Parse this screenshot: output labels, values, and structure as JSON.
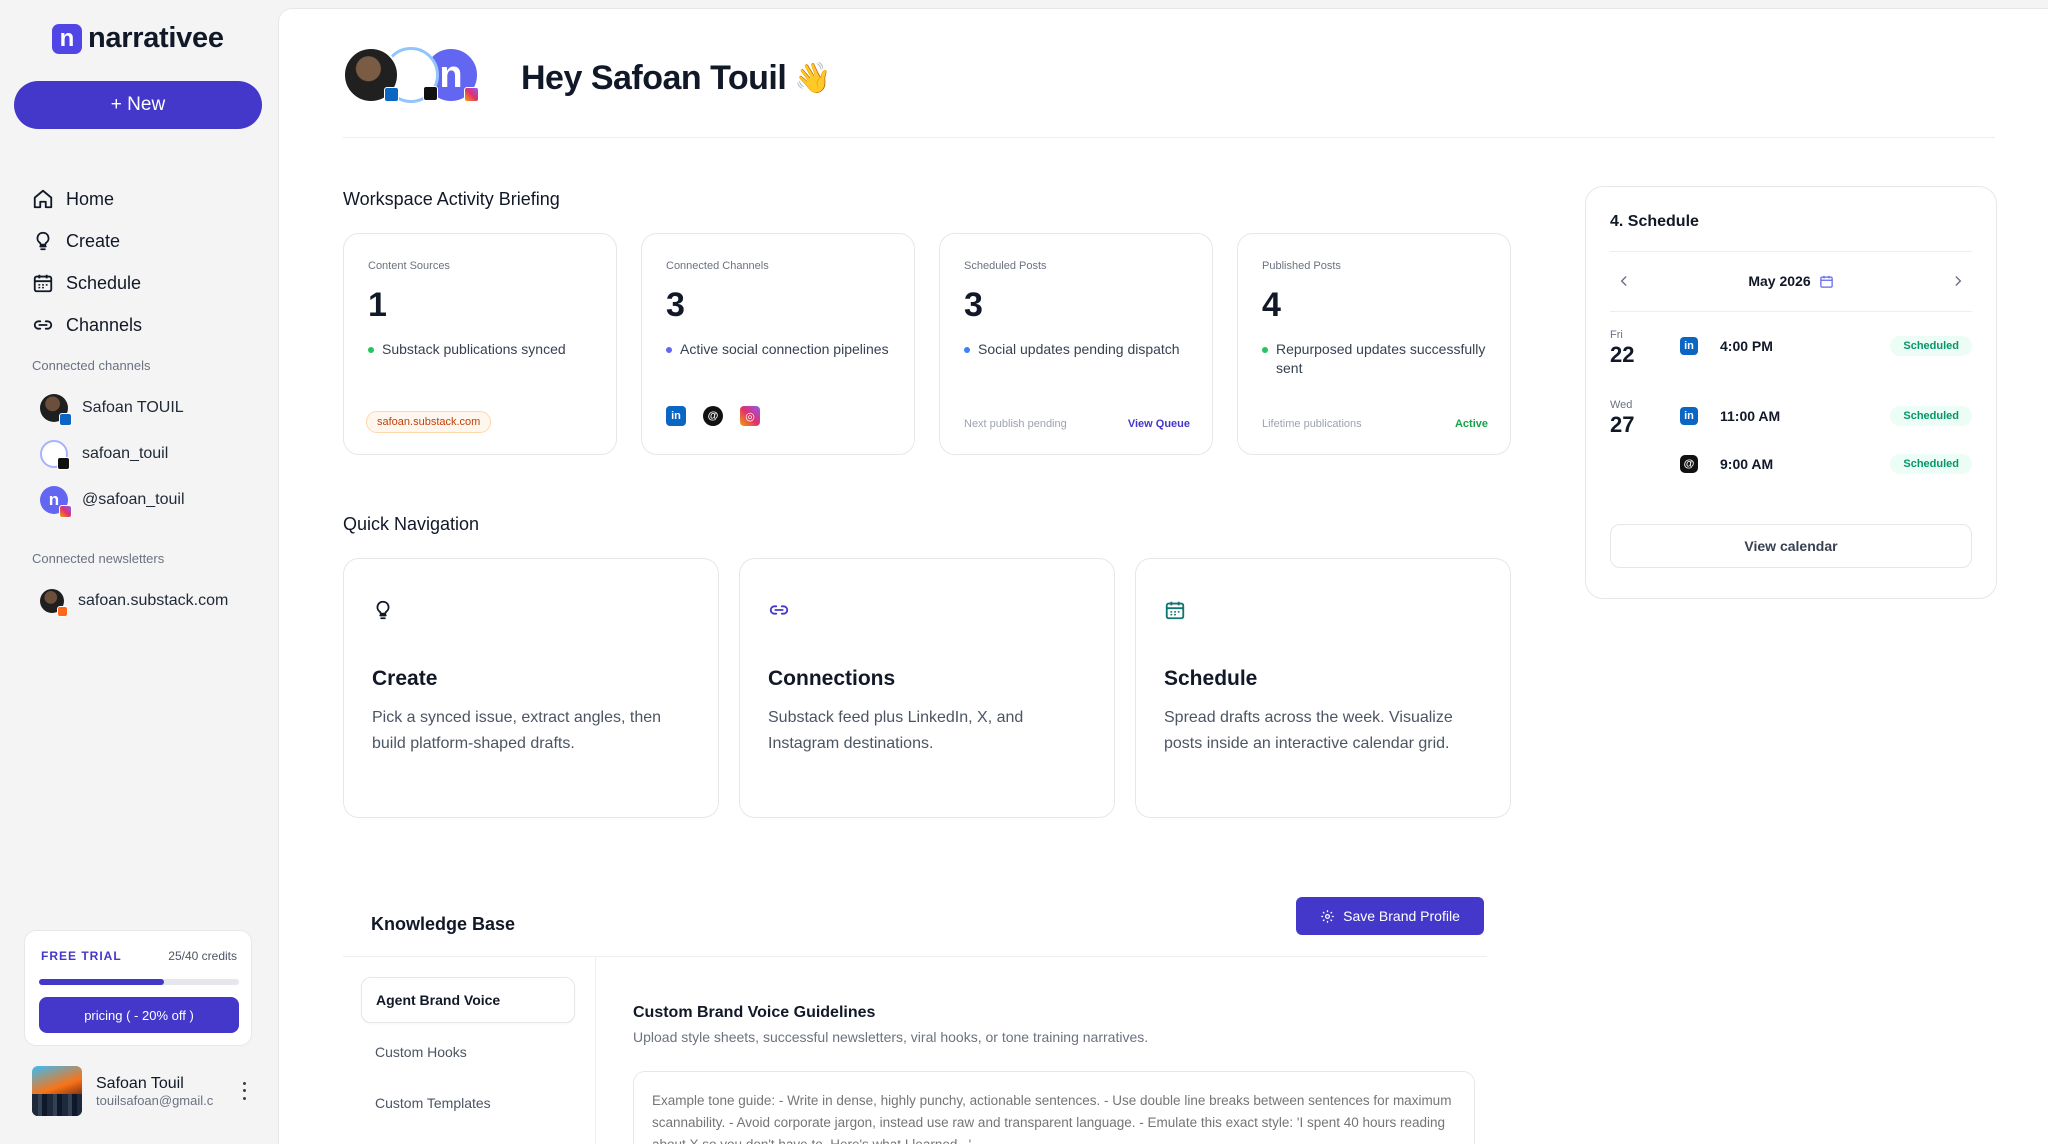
{
  "app": {
    "logo_letter": "n",
    "logo_text": "narrativee"
  },
  "sidebar": {
    "new_label": "+ New",
    "nav": [
      {
        "label": "Home",
        "icon": "home-icon"
      },
      {
        "label": "Create",
        "icon": "lightbulb-icon"
      },
      {
        "label": "Schedule",
        "icon": "calendar-icon"
      },
      {
        "label": "Channels",
        "icon": "link-icon"
      }
    ],
    "connected_channels_label": "Connected channels",
    "channels": [
      {
        "name": "Safoan TOUIL",
        "platform": "linkedin"
      },
      {
        "name": "safoan_touil",
        "platform": "threads"
      },
      {
        "name": "@safoan_touil",
        "platform": "instagram"
      }
    ],
    "connected_newsletters_label": "Connected newsletters",
    "newsletters": [
      {
        "name": "safoan.substack.com",
        "platform": "substack"
      }
    ],
    "trial": {
      "tag": "FREE TRIAL",
      "credits": "25/40 credits",
      "progress": 0.625,
      "pricing_label": "pricing ( - 20% off )"
    },
    "user": {
      "name": "Safoan Touil",
      "email": "touilsafoan@gmail.c"
    }
  },
  "header": {
    "greeting": "Hey Safoan Touil",
    "wave": "👋"
  },
  "briefing": {
    "title": "Workspace Activity Briefing",
    "cards": [
      {
        "label": "Content Sources",
        "value": "1",
        "desc": "Substack publications synced",
        "tag": "safoan.substack.com"
      },
      {
        "label": "Connected Channels",
        "value": "3",
        "desc": "Active social connection pipelines"
      },
      {
        "label": "Scheduled Posts",
        "value": "3",
        "desc": "Social updates pending dispatch",
        "foot_left": "Next publish pending",
        "foot_right": "View Queue"
      },
      {
        "label": "Published Posts",
        "value": "4",
        "desc": "Repurposed updates successfully sent",
        "foot_left": "Lifetime publications",
        "foot_right": "Active"
      }
    ]
  },
  "quick_nav": {
    "title": "Quick Navigation",
    "cards": [
      {
        "title": "Create",
        "body": "Pick a synced issue, extract angles, then build platform-shaped drafts.",
        "icon": "lightbulb-icon"
      },
      {
        "title": "Connections",
        "body": "Substack feed plus LinkedIn, X, and Instagram destinations.",
        "icon": "link-icon"
      },
      {
        "title": "Schedule",
        "body": "Spread drafts across the week. Visualize posts inside an interactive calendar grid.",
        "icon": "calendar-icon"
      }
    ]
  },
  "knowledge_base": {
    "title": "Knowledge Base",
    "save_label": "Save Brand Profile",
    "tabs": [
      "Agent Brand Voice",
      "Custom Hooks",
      "Custom Templates"
    ],
    "heading": "Custom Brand Voice Guidelines",
    "subheading": "Upload style sheets, successful newsletters, viral hooks, or tone training narratives.",
    "placeholder": "Example tone guide: - Write in dense, highly punchy, actionable sentences. - Use double line breaks between sentences for maximum scannability. - Avoid corporate jargon, instead use raw and transparent language. - Emulate this exact style: 'I spent 40 hours reading about X so you don't have to. Here's what I learned...'"
  },
  "schedule": {
    "title": "4. Schedule",
    "month": "May 2026",
    "days": [
      {
        "dow": "Fri",
        "date": "22",
        "slots": [
          {
            "platform": "linkedin",
            "time": "4:00 PM",
            "status": "Scheduled"
          }
        ]
      },
      {
        "dow": "Wed",
        "date": "27",
        "slots": [
          {
            "platform": "linkedin",
            "time": "11:00 AM",
            "status": "Scheduled"
          },
          {
            "platform": "threads",
            "time": "9:00 AM",
            "status": "Scheduled"
          }
        ]
      }
    ],
    "view_label": "View calendar"
  },
  "colors": {
    "accent": "#4338ca",
    "linkedin": "#0a66c2",
    "success": "#16a34a",
    "instagram": "#e1306c"
  }
}
